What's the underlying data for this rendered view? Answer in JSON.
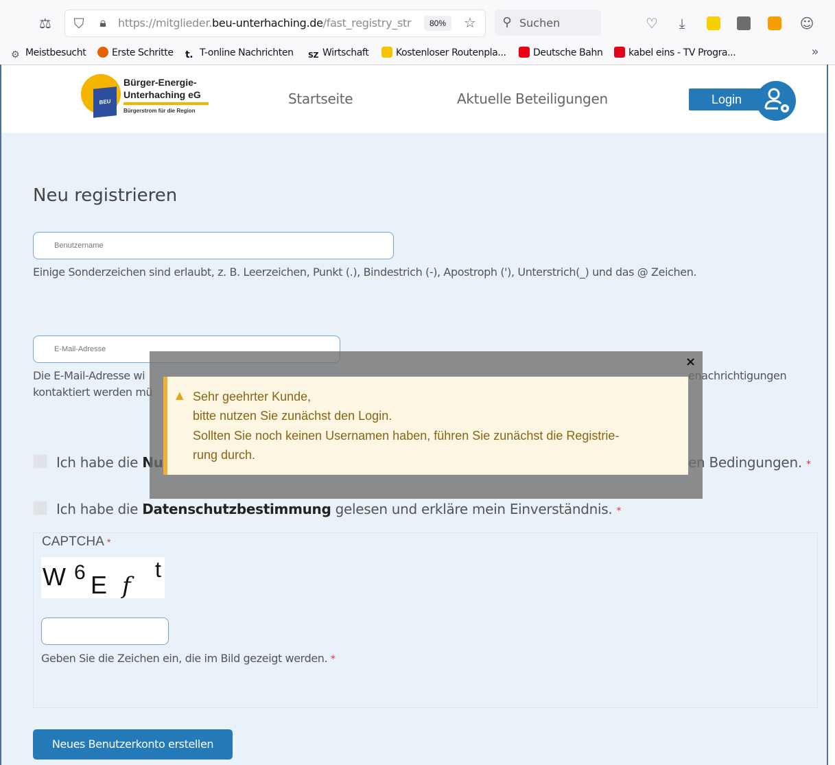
{
  "browser": {
    "url_prefix": "https://mitglieder.",
    "url_domain": "beu-unterhaching.de",
    "url_path": "/fast_registry_str",
    "zoom": "80%",
    "search_label": "Suchen"
  },
  "bookmarks": [
    {
      "label": "Meistbesucht",
      "color": "#5b5b66"
    },
    {
      "label": "Erste Schritte",
      "color": "#e66000"
    },
    {
      "label": "T-online Nachrichten",
      "color": "#15141a"
    },
    {
      "label": "Wirtschaft",
      "color": "#15141a"
    },
    {
      "label": "Kostenloser Routenpla...",
      "color": "#f5c400"
    },
    {
      "label": "Deutsche Bahn",
      "color": "#ec0016"
    },
    {
      "label": "kabel eins - TV Progra...",
      "color": "#e2001a"
    }
  ],
  "header": {
    "logo_line1": "Bürger-Energie-",
    "logo_line2": "Unterhaching eG",
    "logo_tagline": "Bürgerstrom für die Region",
    "logo_badge": "BEU",
    "nav_home": "Startseite",
    "nav_investments": "Aktuelle Beteiligungen",
    "login_label": "Login"
  },
  "form": {
    "title": "Neu registrieren",
    "username_placeholder": "Benutzername",
    "username_hint": "Einige Sonderzeichen sind erlaubt, z. B. Leerzeichen, Punkt (.), Bindestrich (-), Apostroph ('), Unterstrich(_) und das @ Zeichen.",
    "email_placeholder": "E-Mail-Adresse",
    "email_hint_left1": "Die E-Mail-Adresse wi",
    "email_hint_right1": "enachrichtigungen",
    "email_hint_left2": "kontaktiert werden mü",
    "terms_prefix": "Ich habe die ",
    "terms_bold": "Nut",
    "terms_suffix": "en Bedingungen.",
    "privacy_prefix": "Ich habe die ",
    "privacy_bold": "Datenschutzbestimmung",
    "privacy_suffix": " gelesen und erkläre mein Einverständnis.",
    "required_mark": "*",
    "captcha_label": "CAPTCHA",
    "captcha_chars": [
      "W",
      "6",
      "E",
      "f",
      "t"
    ],
    "captcha_hint": "Geben Sie die Zeichen ein, die im Bild gezeigt werden.",
    "submit_label": "Neues Benutzerkonto erstellen"
  },
  "modal": {
    "close_glyph": "×",
    "warning_glyph": "▲",
    "lines": [
      "Sehr geehrter Kunde,",
      "bitte nutzen Sie zunächst den Login.",
      "Sollten Sie noch keinen Usernamen haben, führen Sie zunächst die Registrie-",
      "rung durch."
    ]
  },
  "colors": {
    "brand_blue": "#2479b8",
    "brand_yellow": "#f5b400",
    "warning_border": "#f0b03a"
  }
}
